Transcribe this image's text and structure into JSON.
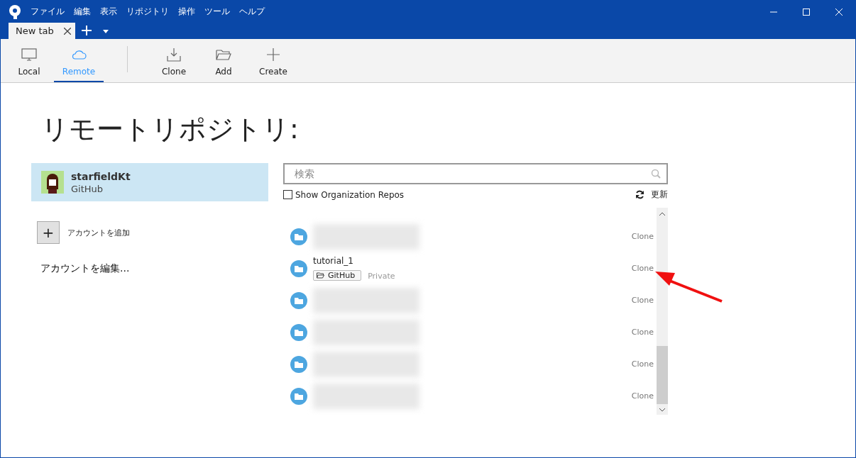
{
  "menu": [
    "ファイル",
    "編集",
    "表示",
    "リポジトリ",
    "操作",
    "ツール",
    "ヘルプ"
  ],
  "tabs": [
    {
      "label": "New tab",
      "selected": true
    }
  ],
  "toolbar": [
    {
      "label": "Local",
      "kind": "monitor",
      "selected": false
    },
    {
      "label": "Remote",
      "kind": "cloud",
      "selected": true
    },
    {
      "label": "Clone",
      "kind": "download",
      "selected": false
    },
    {
      "label": "Add",
      "kind": "folder",
      "selected": false
    },
    {
      "label": "Create",
      "kind": "plus",
      "selected": false
    }
  ],
  "heading": "リモートリポジトリ:",
  "accounts": [
    {
      "name": "starfieldKt",
      "service": "GitHub",
      "selected": true
    }
  ],
  "add_account": {
    "icon": "+",
    "label": "アカウントを追加"
  },
  "edit_accounts": "アカウントを編集...",
  "search": {
    "placeholder": "検索"
  },
  "show_org_repos": {
    "label": "Show Organization Repos",
    "checked": false
  },
  "refresh": "更新",
  "repos": [
    {
      "kind": "blurred",
      "action": "Clone"
    },
    {
      "kind": "named",
      "name": "tutorial_1",
      "source": "GitHub",
      "visibility": "Private",
      "action": "Clone"
    },
    {
      "kind": "blurred",
      "action": "Clone"
    },
    {
      "kind": "blurred",
      "action": "Clone"
    },
    {
      "kind": "blurred",
      "action": "Clone"
    },
    {
      "kind": "blurred",
      "action": "Clone"
    }
  ]
}
